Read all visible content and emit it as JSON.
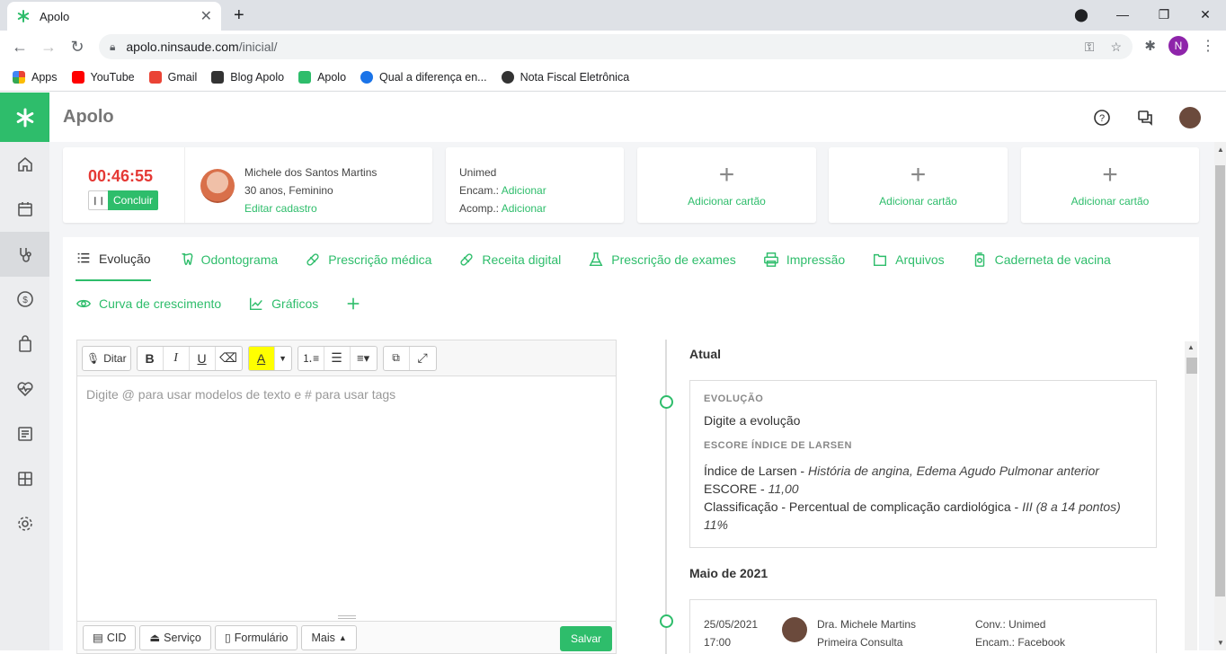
{
  "browser": {
    "tab_title": "Apolo",
    "url_host": "apolo.ninsaude.com",
    "url_path": "/inicial/",
    "profile_initial": "N",
    "bookmarks": [
      {
        "label": "Apps",
        "icon": "apps-grid-icon"
      },
      {
        "label": "YouTube",
        "icon": "youtube-icon"
      },
      {
        "label": "Gmail",
        "icon": "gmail-icon"
      },
      {
        "label": "Blog Apolo",
        "icon": "blog-icon"
      },
      {
        "label": "Apolo",
        "icon": "apolo-icon"
      },
      {
        "label": "Qual a diferença en...",
        "icon": "circle-icon"
      },
      {
        "label": "Nota Fiscal Eletrônica",
        "icon": "globe-icon"
      }
    ]
  },
  "app": {
    "title": "Apolo",
    "accent": "#2ebd6b"
  },
  "session": {
    "timer": "00:46:55",
    "finish_label": "Concluir"
  },
  "patient": {
    "name": "Michele dos Santos Martins",
    "age_sex": "30 anos, Feminino",
    "edit_link": "Editar cadastro"
  },
  "insurance": {
    "name": "Unimed",
    "encam_label": "Encam.:",
    "encam_link": "Adicionar",
    "acomp_label": "Acomp.:",
    "acomp_link": "Adicionar"
  },
  "add_cards": [
    "Adicionar cartão",
    "Adicionar cartão",
    "Adicionar cartão"
  ],
  "tabs": {
    "row1": [
      {
        "label": "Evolução",
        "icon": "list-icon"
      },
      {
        "label": "Odontograma",
        "icon": "tooth-icon"
      },
      {
        "label": "Prescrição médica",
        "icon": "pill-icon"
      },
      {
        "label": "Receita digital",
        "icon": "pill-icon"
      },
      {
        "label": "Prescrição de exames",
        "icon": "flask-icon"
      },
      {
        "label": "Impressão",
        "icon": "printer-icon"
      },
      {
        "label": "Arquivos",
        "icon": "folder-icon"
      },
      {
        "label": "Caderneta de vacina",
        "icon": "vaccine-icon"
      }
    ],
    "row2": [
      {
        "label": "Curva de crescimento",
        "icon": "eye-icon"
      },
      {
        "label": "Gráficos",
        "icon": "chart-icon"
      }
    ]
  },
  "editor": {
    "dictate_label": "Ditar",
    "placeholder": "Digite @ para usar modelos de texto e # para usar tags",
    "bottom_buttons": [
      "CID",
      "Serviço",
      "Formulário",
      "Mais"
    ],
    "save_label": "Salvar"
  },
  "timeline": {
    "current_heading": "Atual",
    "evolution_label": "EVOLUÇÃO",
    "evolution_text": "Digite a evolução",
    "score_label": "ESCORE ÍNDICE DE LARSEN",
    "score_lines": {
      "l1_label": "Índice de Larsen - ",
      "l1_value": "História de angina, Edema Agudo Pulmonar anterior",
      "l2_label": "ESCORE - ",
      "l2_value": "11,00",
      "l3_label": "Classificação - Percentual de complicação cardiológica - ",
      "l3_value": "III (8 a 14 pontos)",
      "l4_value": "11%"
    },
    "past_heading": "Maio de 2021",
    "entry": {
      "date": "25/05/2021",
      "time": "17:00",
      "doctor": "Dra. Michele Martins",
      "type": "Primeira Consulta",
      "conv": "Conv.: Unimed",
      "encam": "Encam.: Facebook"
    }
  }
}
